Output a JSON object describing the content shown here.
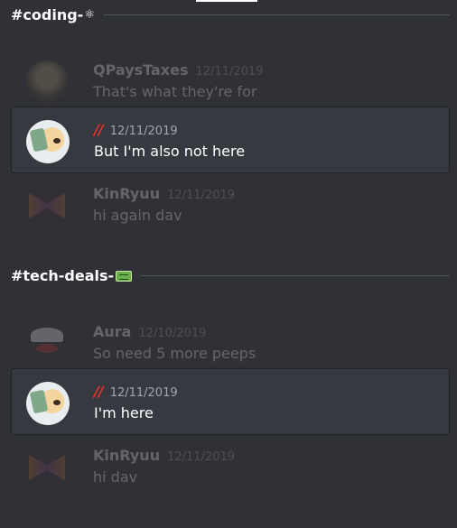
{
  "sections": [
    {
      "channel": "#coding-",
      "emoji": "⚛",
      "messages": [
        {
          "author": "QPaysTaxes",
          "timestamp": "12/11/2019",
          "text": "That's what they're for"
        },
        {
          "author": "//",
          "timestamp": "12/11/2019",
          "text": "But I'm also not here"
        },
        {
          "author": "KinRyuu",
          "timestamp": "12/11/2019",
          "text": "hi again dav"
        }
      ]
    },
    {
      "channel": "#tech-deals-",
      "emoji": "money-emoji",
      "messages": [
        {
          "author": "Aura",
          "timestamp": "12/10/2019",
          "text": "So need 5 more peeps"
        },
        {
          "author": "//",
          "timestamp": "12/11/2019",
          "text": "I'm here"
        },
        {
          "author": "KinRyuu",
          "timestamp": "12/11/2019",
          "text": "hi dav"
        }
      ]
    }
  ]
}
